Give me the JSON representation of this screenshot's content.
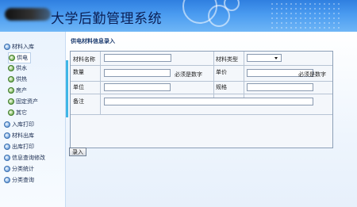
{
  "header": {
    "title": "大学后勤管理系统"
  },
  "sidebar": {
    "items": [
      {
        "label": "材料入库"
      },
      {
        "label": "供电"
      },
      {
        "label": "供水"
      },
      {
        "label": "供热"
      },
      {
        "label": "房产"
      },
      {
        "label": "固定资产"
      },
      {
        "label": "其它"
      },
      {
        "label": "入库打印"
      },
      {
        "label": "材料出库"
      },
      {
        "label": "出库打印"
      },
      {
        "label": "信息查询修改"
      },
      {
        "label": "分类统计"
      },
      {
        "label": "分类查询"
      }
    ]
  },
  "form": {
    "title": "供电材料信息录入",
    "material_name_label": "材料名称",
    "material_type_label": "材料类型",
    "quantity_label": "数量",
    "quantity_hint": "必须是数字",
    "unit_price_label": "单价",
    "unit_price_hint": "必须是数字",
    "unit_label": "单位",
    "spec_label": "规格",
    "remark_label": "备注",
    "submit_label": "录入"
  }
}
